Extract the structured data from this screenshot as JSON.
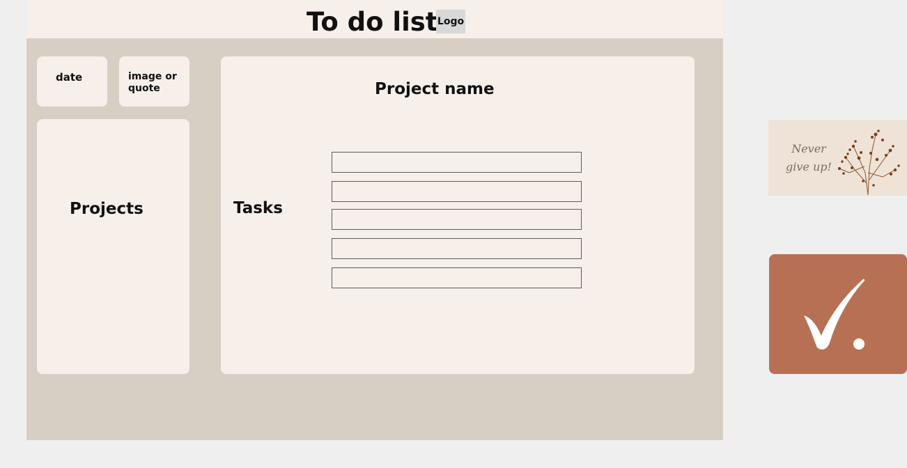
{
  "header": {
    "title": "To do list",
    "logo_label": "Logo"
  },
  "sidebar": {
    "date_label": "date",
    "quote_label": "image or quote",
    "projects_title": "Projects"
  },
  "main": {
    "project_name": "Project name",
    "tasks_label": "Tasks",
    "task_fields": [
      "",
      "",
      "",
      "",
      ""
    ]
  },
  "side_assets": {
    "quote_text": "Never give up!",
    "check_tile_color": "#b87055",
    "quote_background": "#efe3d7",
    "check_icon": "checkmark-icon",
    "plant_icon": "dried-flowers-icon"
  },
  "colors": {
    "page_background": "#efefef",
    "frame_background": "#d7cfc4",
    "card_background": "#f7efea",
    "logo_background": "#d8d8d8"
  }
}
